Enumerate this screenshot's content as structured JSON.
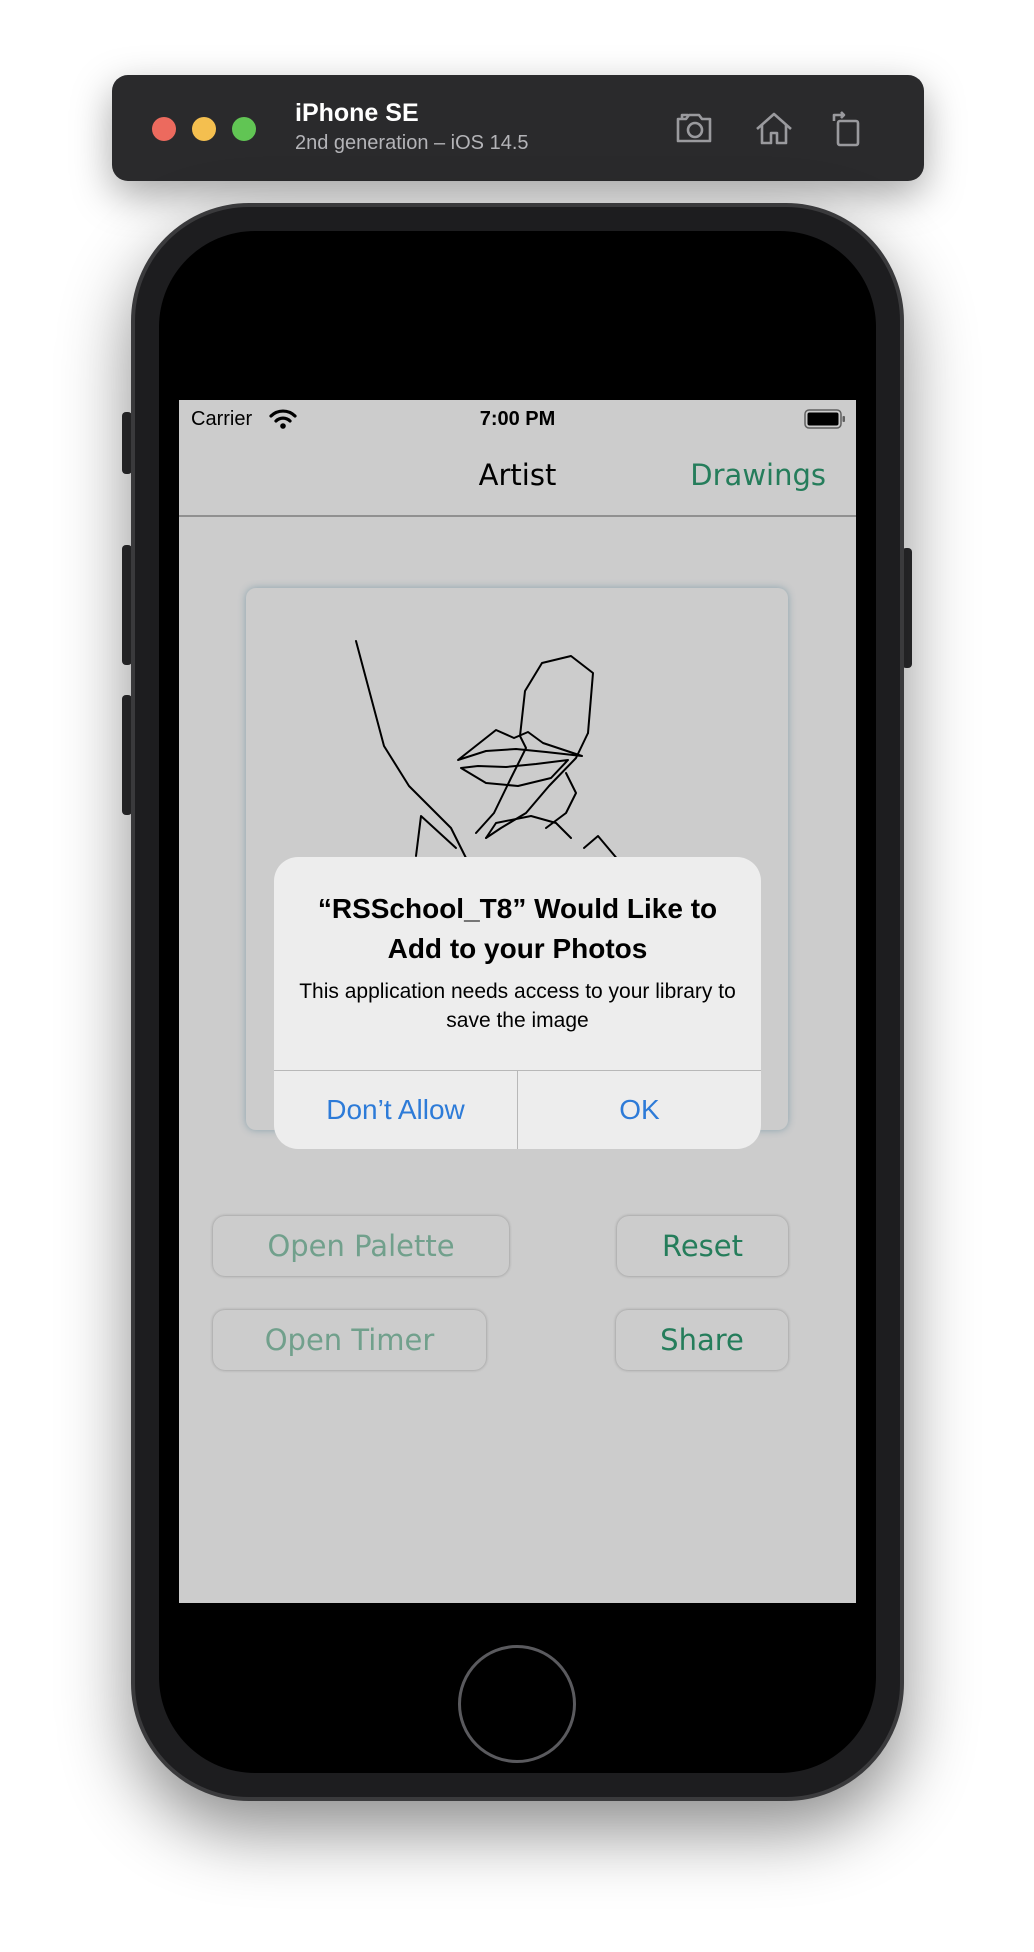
{
  "simulator": {
    "device_name": "iPhone SE",
    "device_detail": "2nd generation – iOS 14.5",
    "icons": [
      "screenshot-icon",
      "home-icon",
      "rotate-icon"
    ]
  },
  "status_bar": {
    "carrier": "Carrier",
    "time": "7:00 PM"
  },
  "nav": {
    "title": "Artist",
    "right_button": "Drawings"
  },
  "buttons": {
    "open_palette": "Open Palette",
    "reset": "Reset",
    "open_timer": "Open Timer",
    "share": "Share"
  },
  "alert": {
    "title": "“RSSchool_T8” Would Like to Add to your Photos",
    "message": "This application needs access to your library to save the image",
    "deny_label": "Don’t Allow",
    "ok_label": "OK"
  },
  "colors": {
    "accent_green": "#2f9d72",
    "alert_blue": "#2d7bd8"
  }
}
